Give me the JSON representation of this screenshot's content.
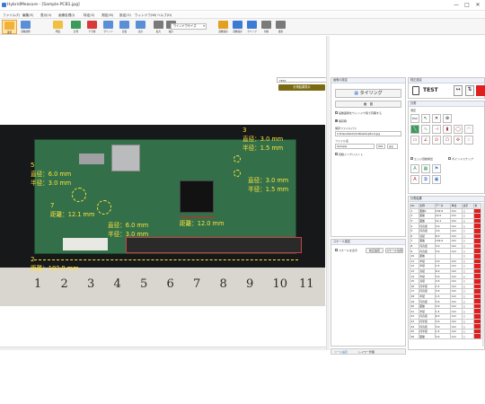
{
  "window": {
    "title": "HybridMeasure - [Sample-PCB1.jpg]",
    "controls": [
      "—",
      "□",
      "✕"
    ]
  },
  "menu": [
    "ファイル(F)",
    "編集(E)",
    "表示(V)",
    "画像処理(I)",
    "特定(S)",
    "測定(M)",
    "設定(O)",
    "ウィンドウ(W)",
    "ヘルプ(H)"
  ],
  "toolbar": {
    "items": [
      {
        "label": "選択",
        "icon": "cursor-icon",
        "color": "#f2b23a",
        "active": true
      },
      {
        "label": "画像調整",
        "icon": "image-adjust-icon",
        "color": "#5a8fd8"
      },
      {
        "label": "明度",
        "icon": "brightness-icon",
        "color": "#f0c040"
      },
      {
        "label": "計測",
        "icon": "measure-icon",
        "color": "#3c9a5a"
      },
      {
        "label": "十字線",
        "icon": "crosshair-icon",
        "color": "#d83a3a"
      },
      {
        "label": "グリッド",
        "icon": "grid-icon",
        "color": "#5a8fd8"
      },
      {
        "label": "比較",
        "icon": "compare-icon",
        "color": "#5a8fd8"
      },
      {
        "label": "表示",
        "icon": "display-icon",
        "color": "#5a8fd8"
      },
      {
        "label": "拡大",
        "icon": "zoom-in-icon",
        "color": "#7a7a7a"
      },
      {
        "label": "縮小",
        "icon": "zoom-out-icon",
        "color": "#7a7a7a"
      }
    ],
    "zoom_value": "ウインドウサイズ",
    "right_items": [
      {
        "label": "画像保存",
        "icon": "save-image-icon",
        "color": "#e3a020"
      },
      {
        "label": "画像保存",
        "icon": "save-icon",
        "color": "#3b7bd4"
      },
      {
        "label": "クリップ",
        "icon": "clip-icon",
        "color": "#3b7bd4"
      },
      {
        "label": "印刷",
        "icon": "print-icon",
        "color": "#7a7a7a"
      },
      {
        "label": "検索",
        "icon": "search-icon",
        "color": "#7a7a7a"
      }
    ]
  },
  "viewport": {
    "top_label": "TEST",
    "overlay_button": "計測結果表示",
    "annotations": [
      {
        "num": "5",
        "lines": [
          "直径：6.0 mm",
          "半径：3.0 mm"
        ]
      },
      {
        "num": "7",
        "lines": [
          "距離：12.1 mm"
        ]
      },
      {
        "num": "3",
        "lines": [
          "直径：3.0 mm",
          "半径：1.5 mm"
        ]
      },
      {
        "num": "",
        "lines": [
          "直径：3.0 mm",
          "半径：1.5 mm"
        ]
      },
      {
        "num": "",
        "lines": [
          "直径：6.0 mm",
          "半径：3.0 mm"
        ]
      },
      {
        "num": "",
        "lines": [
          "距離：12.0 mm"
        ]
      },
      {
        "num": "2",
        "lines": [
          "距離：102.9 mm"
        ]
      }
    ],
    "ruler_numbers": [
      "1",
      "2",
      "3",
      "4",
      "5",
      "6",
      "7",
      "8",
      "9",
      "10",
      "11"
    ]
  },
  "panel_tiling": {
    "header": "画像の設定",
    "button_tiling": "タイリング",
    "button_sub1": "画",
    "button_sub2": "設",
    "check_sync": "画像座標をウィンドウ間で同期する",
    "check_save": "保存時",
    "path_label": "保存ファイルパス",
    "path_value": "C:¥Users¥Admin¥Desktop¥out.jpg",
    "file_label": "ファイル名",
    "file_value": "Sample",
    "num_value": "001",
    "ext_value": "jpg",
    "check_auto": "自動インクリメント"
  },
  "panel_scale": {
    "header": "スケール設定",
    "check": "スケールを表示",
    "btn1": "校正設定",
    "btn2": "スケール位置"
  },
  "panel_bottom_tabs": [
    "ツール設定",
    "レイヤー管理"
  ],
  "panel_calib": {
    "header": "校正設定",
    "value": "TEST",
    "icons": [
      "calibrate-icon",
      "arrow-icon",
      "color-icon"
    ]
  },
  "panel_tools": {
    "header": "計測",
    "mode_label": "測定",
    "buttons_row1": [
      "ESC",
      "↖",
      "✕",
      "⊕"
    ],
    "tools": [
      {
        "name": "line-tool-icon",
        "glyph": "╲",
        "color": "#3c9a5a"
      },
      {
        "name": "polyline-tool-icon",
        "glyph": "∿",
        "color": "#3c9a5a"
      },
      {
        "name": "measure-tool-icon",
        "glyph": "⊣",
        "color": "#b03030"
      },
      {
        "name": "chart-tool-icon",
        "glyph": "▮",
        "color": "#b03030"
      },
      {
        "name": "circle-tool-icon",
        "glyph": "◯",
        "color": "#b03030"
      },
      {
        "name": "arc-tool-icon",
        "glyph": "◠",
        "color": "#b03030"
      },
      {
        "name": "rect-tool-icon",
        "glyph": "▭",
        "color": "#b03030"
      },
      {
        "name": "angle-tool-icon",
        "glyph": "∠",
        "color": "#b03030"
      },
      {
        "name": "count-tool-icon",
        "glyph": "⊙",
        "color": "#b03030"
      },
      {
        "name": "area-tool-icon",
        "glyph": "⬠",
        "color": "#b03030"
      },
      {
        "name": "point-tool-icon",
        "glyph": "✣",
        "color": "#b03030"
      },
      {
        "name": "multi-tool-icon",
        "glyph": "⁙",
        "color": "#b03030"
      }
    ],
    "check_snap": "エッジ自動検出",
    "check_point": "ポイントスナップ",
    "tools_row2": [
      {
        "name": "text-tool-icon",
        "glyph": "A",
        "color": "#3c9a5a"
      },
      {
        "name": "grid-tool-icon",
        "glyph": "▦",
        "color": "#3c9a5a"
      },
      {
        "name": "flag-tool-icon",
        "glyph": "⚑",
        "color": "#3b7bd4"
      },
      {
        "name": "text2-tool-icon",
        "glyph": "A",
        "color": "#b03030"
      },
      {
        "name": "copy-tool-icon",
        "glyph": "⧉",
        "color": "#3b7bd4"
      },
      {
        "name": "save-tool-icon",
        "glyph": "▣",
        "color": "#3b7bd4"
      }
    ]
  },
  "panel_results": {
    "header": "計測結果",
    "columns": [
      "No",
      "名称",
      "データ",
      "単位",
      "表示",
      "色"
    ],
    "rows": [
      [
        "1",
        "距離1",
        "102.9",
        "mm",
        "○",
        ""
      ],
      [
        "2",
        "距離",
        "12.0",
        "mm",
        "○",
        ""
      ],
      [
        "3",
        "距離",
        "12.1",
        "mm",
        "○",
        ""
      ],
      [
        "4",
        "円直径",
        "3.0",
        "mm",
        "○",
        ""
      ],
      [
        "5",
        "円直径",
        "3.0",
        "mm",
        "○",
        ""
      ],
      [
        "6",
        "直径",
        "6.0",
        "mm",
        "○",
        ""
      ],
      [
        "7",
        "距離",
        "102.9",
        "mm",
        "○",
        ""
      ],
      [
        "8",
        "円直径",
        "3.0",
        "mm",
        "○",
        ""
      ],
      [
        "9",
        "円直径",
        "3.0",
        "mm",
        "○",
        ""
      ],
      [
        "10",
        "距離",
        "",
        "",
        "○",
        ""
      ],
      [
        "11",
        "半径",
        "3.0",
        "mm",
        "○",
        ""
      ],
      [
        "12",
        "半径",
        "1.5",
        "mm",
        "○",
        ""
      ],
      [
        "13",
        "直径",
        "6.0",
        "mm",
        "○",
        ""
      ],
      [
        "14",
        "半径",
        "3.0",
        "mm",
        "○",
        ""
      ],
      [
        "15",
        "直径",
        "3.0",
        "mm",
        "○",
        ""
      ],
      [
        "16",
        "円半径",
        "1.5",
        "mm",
        "○",
        ""
      ],
      [
        "17",
        "円直径",
        "3.0",
        "mm",
        "○",
        ""
      ],
      [
        "18",
        "半径",
        "1.5",
        "mm",
        "○",
        ""
      ],
      [
        "19",
        "円直径",
        "3.0",
        "mm",
        "○",
        ""
      ],
      [
        "20",
        "距離",
        "3.0",
        "mm",
        "○",
        ""
      ],
      [
        "21",
        "半径",
        "1.5",
        "mm",
        "○",
        ""
      ],
      [
        "22",
        "円直径",
        "6.0",
        "mm",
        "○",
        ""
      ],
      [
        "23",
        "円半径",
        "3.0",
        "mm",
        "○",
        ""
      ],
      [
        "24",
        "円直径",
        "3.0",
        "mm",
        "○",
        ""
      ],
      [
        "25",
        "円半径",
        "1.5",
        "mm",
        "○",
        ""
      ],
      [
        "26",
        "距離",
        "3.0",
        "mm",
        "○",
        ""
      ]
    ]
  },
  "colors": {
    "accent": "#ffe23b",
    "alert": "#e02020",
    "panel_head": "#eef2f8",
    "pcb": "#33704a"
  }
}
